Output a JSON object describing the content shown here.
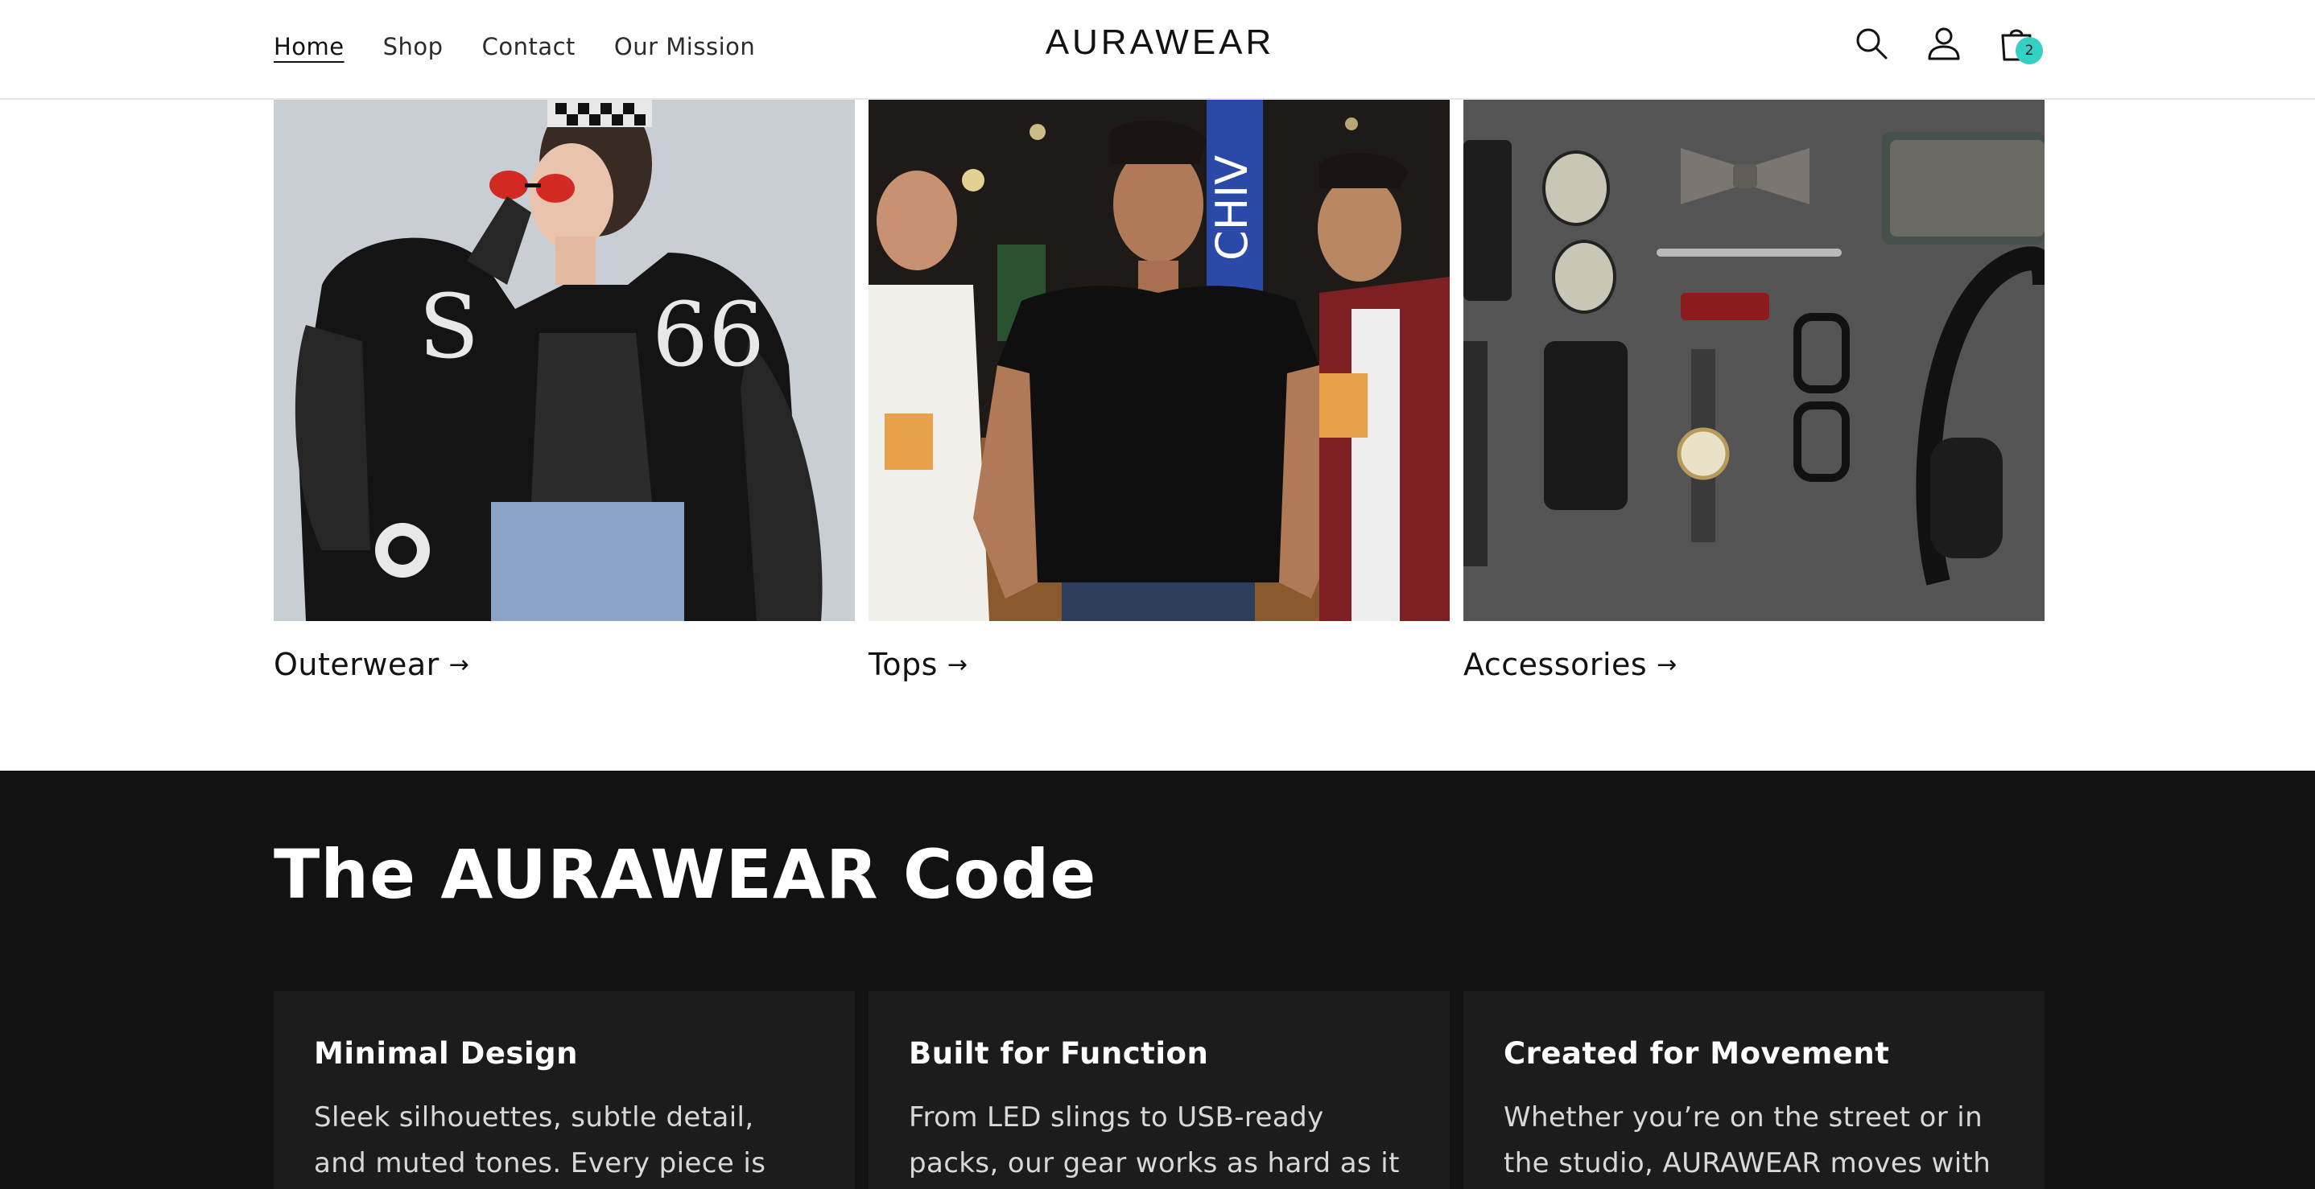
{
  "header": {
    "nav": [
      {
        "label": "Home",
        "active": true
      },
      {
        "label": "Shop",
        "active": false
      },
      {
        "label": "Contact",
        "active": false
      },
      {
        "label": "Our Mission",
        "active": false
      }
    ],
    "logo": "AURAWEAR",
    "icons": [
      "search-icon",
      "account-icon",
      "cart-icon"
    ],
    "cart_count": "2",
    "cart_badge_color": "#35d0c4"
  },
  "collections": [
    {
      "label": "Outerwear",
      "image": "woman in black varsity jacket and sunglasses"
    },
    {
      "label": "Tops",
      "image": "three young men in a bar, center in black polo shirt"
    },
    {
      "label": "Accessories",
      "image": "flat lay of sunglasses, bow tie, phone, watch, glasses, headphones"
    }
  ],
  "arrow": "→",
  "code_section": {
    "title": "The AURAWEAR Code",
    "background": "#121212",
    "features": [
      {
        "title": "Minimal Design",
        "text": "Sleek silhouettes, subtle detail, and muted tones. Every piece is crafted to"
      },
      {
        "title": "Built for Function",
        "text": "From LED slings to USB-ready packs, our gear works as hard as it looks."
      },
      {
        "title": "Created for Movement",
        "text": "Whether you’re on the street or in the studio, AURAWEAR moves with you."
      }
    ]
  }
}
